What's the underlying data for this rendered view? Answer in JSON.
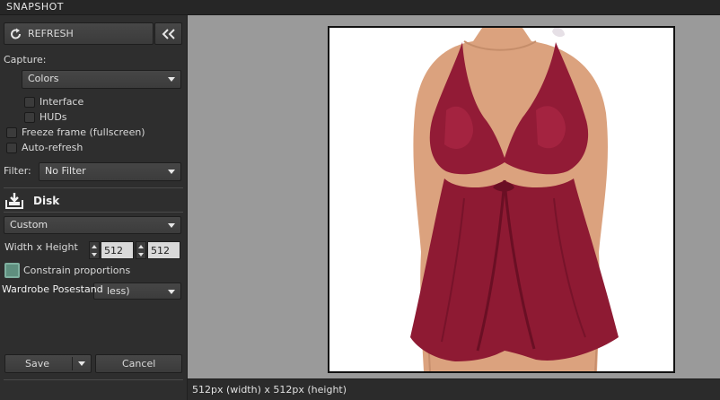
{
  "window": {
    "title": "SNAPSHOT"
  },
  "panel": {
    "refresh_label": "REFRESH",
    "capture_label": "Capture:",
    "capture_value": "Colors",
    "interface_label": "Interface",
    "huds_label": "HUDs",
    "freeze_label": "Freeze frame (fullscreen)",
    "autorefresh_label": "Auto-refresh",
    "filter_label": "Filter:",
    "filter_value": "No Filter",
    "disk_label": "Disk",
    "size_preset": "Custom",
    "wh_label": "Width x Height",
    "width_value": "512",
    "height_value": "512",
    "constrain_label": "Constrain proportions",
    "overlay_text": "Wardrobe Posestand",
    "format_partial": "less)",
    "save_label": "Save",
    "cancel_label": "Cancel"
  },
  "status": {
    "text": "512px (width) x 512px (height)"
  },
  "colors": {
    "dress": "#8e1a33",
    "skin": "#d9a07c",
    "accent": "#5f8f7f"
  }
}
